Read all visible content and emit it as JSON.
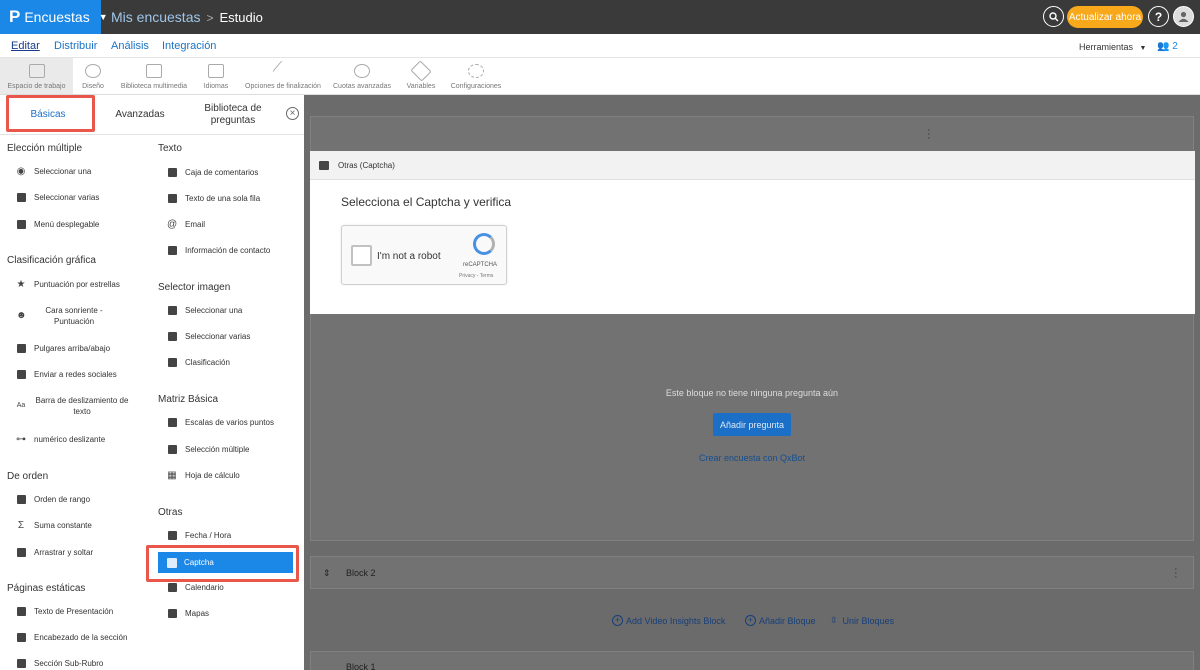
{
  "topbar": {
    "app_logo": "P",
    "app_name": "Encuestas",
    "breadcrumb_parent": "Mis encuestas",
    "breadcrumb_sep": ">",
    "breadcrumb_current": "Estudio",
    "upgrade_label": "Actualizar ahora",
    "help_label": "?"
  },
  "menubar": {
    "items": [
      "Editar",
      "Distribuir",
      "Análisis",
      "Integración"
    ],
    "tools_label": "Herramientas",
    "users_count": "2"
  },
  "toolbar": {
    "items": [
      "Espacio de trabajo",
      "Diseño",
      "Biblioteca multimedia",
      "Idiomas",
      "Opciones de finalización",
      "Cuotas avanzadas",
      "Variables",
      "Configuraciones"
    ]
  },
  "panel": {
    "tabs": [
      "Básicas",
      "Avanzadas",
      "Biblioteca de preguntas"
    ],
    "left": {
      "s1": "Elección múltiple",
      "s1_items": [
        "Seleccionar una",
        "Seleccionar varias",
        "Menú desplegable"
      ],
      "s2": "Clasificación gráfica",
      "s2_items": [
        "Puntuación por estrellas",
        "Cara sonriente - Puntuación",
        "Pulgares arriba/abajo",
        "Enviar a redes sociales",
        "Barra de deslizamiento de texto",
        "numérico deslizante"
      ],
      "s3": "De orden",
      "s3_items": [
        "Orden de rango",
        "Suma constante",
        "Arrastrar y soltar"
      ],
      "s4": "Páginas estáticas",
      "s4_items": [
        "Texto de Presentación",
        "Encabezado de la sección",
        "Sección Sub-Rubro"
      ]
    },
    "right": {
      "s1": "Texto",
      "s1_items": [
        "Caja de comentarios",
        "Texto de una sola fila",
        "Email",
        "Información de contacto"
      ],
      "s2": "Selector imagen",
      "s2_items": [
        "Seleccionar una",
        "Seleccionar varias",
        "Clasificación"
      ],
      "s3": "Matriz Básica",
      "s3_items": [
        "Escalas de varios puntos",
        "Selección múltiple",
        "Hoja de cálculo"
      ],
      "s4": "Otras",
      "s4_items": [
        "Fecha / Hora",
        "Captcha",
        "Calendario",
        "Mapas"
      ]
    }
  },
  "dialog": {
    "header": "Otras (Captcha)",
    "question": "Selecciona el Captcha y verifica",
    "captcha_text": "I'm not a robot",
    "captcha_brand": "reCAPTCHA",
    "captcha_links": "Privacy - Terms"
  },
  "canvas": {
    "empty_text": "Este bloque no tiene ninguna pregunta aún",
    "add_question": "Añadir pregunta",
    "qxbot_link": "Crear encuesta con QxBot",
    "block2": "Block 2",
    "block1": "Block 1",
    "footer": [
      "Add Video Insights Block",
      "Añadir Bloque",
      "Unir Bloques"
    ]
  }
}
